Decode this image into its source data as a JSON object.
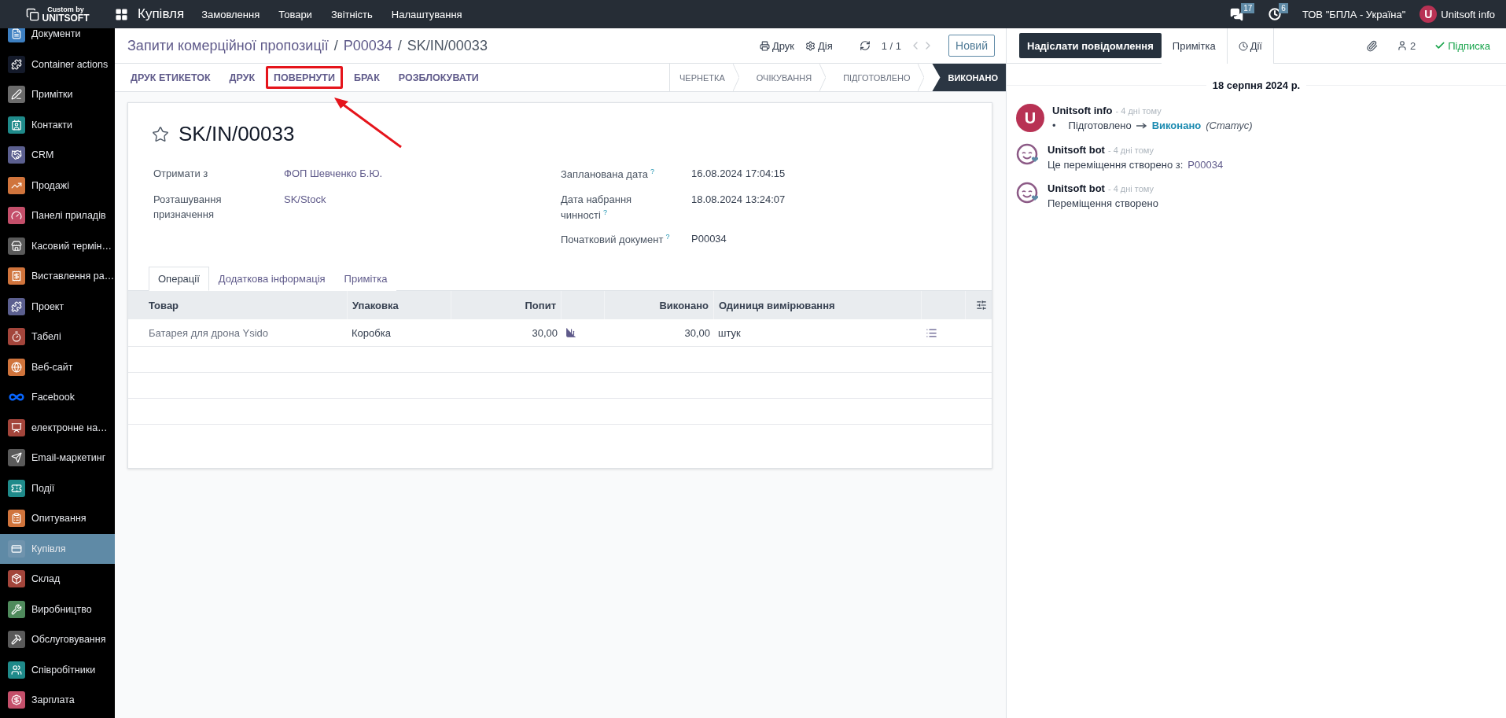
{
  "topbar": {
    "logo_top": "Custom by",
    "logo_bottom": "UNITSOFT",
    "app": "Купівля",
    "menus": [
      "Замовлення",
      "Товари",
      "Звітність",
      "Налаштування"
    ],
    "messages_count": "17",
    "activities_count": "6",
    "company": "ТОВ \"БПЛА - Україна\"",
    "user_initial": "U",
    "user": "Unitsoft info"
  },
  "sidebar": {
    "items": [
      {
        "label": "Документи",
        "kind": "documents",
        "color": "#3d7fc1",
        "selected": false
      },
      {
        "label": "Container actions",
        "kind": "puzzle",
        "color": "#141a2a",
        "selected": false
      },
      {
        "label": "Примітки",
        "kind": "notes",
        "color": "#6b6b6b",
        "selected": false
      },
      {
        "label": "Контакти",
        "kind": "contacts",
        "color": "#1f8a8a",
        "selected": false
      },
      {
        "label": "CRM",
        "kind": "handshake",
        "color": "#5b5f8f",
        "selected": false
      },
      {
        "label": "Продажі",
        "kind": "chart",
        "color": "#d0743c",
        "selected": false
      },
      {
        "label": "Панелі приладів",
        "kind": "gauge",
        "color": "#c44f6a",
        "selected": false
      },
      {
        "label": "Касовий термін…",
        "kind": "store",
        "color": "#5a5a5a",
        "selected": false
      },
      {
        "label": "Виставлення ра…",
        "kind": "invoice",
        "color": "#d0743c",
        "selected": false
      },
      {
        "label": "Проект",
        "kind": "puzzle",
        "color": "#5b5f8f",
        "selected": false
      },
      {
        "label": "Табелі",
        "kind": "timer",
        "color": "#a3453b",
        "selected": false
      },
      {
        "label": "Веб-сайт",
        "kind": "globe",
        "color": "#d0743c",
        "selected": false
      },
      {
        "label": "Facebook",
        "kind": "meta",
        "color": "#0866ff",
        "selected": false
      },
      {
        "label": "електронне на…",
        "kind": "presentation",
        "color": "#a3453b",
        "selected": false
      },
      {
        "label": "Email-маркетинг",
        "kind": "send",
        "color": "#5a5a5a",
        "selected": false
      },
      {
        "label": "Події",
        "kind": "ticket",
        "color": "#1f8a8a",
        "selected": false
      },
      {
        "label": "Опитування",
        "kind": "survey",
        "color": "#d0743c",
        "selected": false
      },
      {
        "label": "Купівля",
        "kind": "card",
        "color": "#6f93ad",
        "selected": true
      },
      {
        "label": "Склад",
        "kind": "package",
        "color": "#a3453b",
        "selected": false
      },
      {
        "label": "Виробництво",
        "kind": "wrench",
        "color": "#4f8a5c",
        "selected": false
      },
      {
        "label": "Обслуговування",
        "kind": "hammer",
        "color": "#5a5a5a",
        "selected": false
      },
      {
        "label": "Співробітники",
        "kind": "users",
        "color": "#1f8a8a",
        "selected": false
      },
      {
        "label": "Зарплата",
        "kind": "payroll",
        "color": "#c44f6a",
        "selected": false
      }
    ]
  },
  "breadcrumbs": [
    "Запити комерційної пропозиції",
    "P00034",
    "SK/IN/00033"
  ],
  "breadcrumb_separator": "/",
  "control": {
    "print": "Друк",
    "action": "Дія",
    "pager": "1 / 1",
    "new": "Новий"
  },
  "actions": [
    {
      "label": "ДРУК ЕТИКЕТОК",
      "highlighted": false
    },
    {
      "label": "ДРУК",
      "highlighted": false
    },
    {
      "label": "ПОВЕРНУТИ",
      "highlighted": true
    },
    {
      "label": "БРАК",
      "highlighted": false
    },
    {
      "label": "РОЗБЛОКУВАТИ",
      "highlighted": false
    }
  ],
  "annotation_arrow": true,
  "stages": [
    {
      "label": "ЧЕРНЕТКА",
      "selected": false
    },
    {
      "label": "ОЧІКУВАННЯ",
      "selected": false
    },
    {
      "label": "ПІДГОТОВЛЕНО",
      "selected": false
    },
    {
      "label": "ВИКОНАНО",
      "selected": true
    }
  ],
  "record": {
    "title": "SK/IN/00033",
    "starred": false,
    "left_fields": [
      {
        "label": "Отримати з",
        "value": "ФОП Шевченко Б.Ю.",
        "kind": "link"
      },
      {
        "label": "Розташування призначення",
        "value": "SK/Stock",
        "kind": "link"
      }
    ],
    "right_fields": [
      {
        "label": "Запланована дата",
        "help": "?",
        "value": "16.08.2024 17:04:15"
      },
      {
        "label": "Дата набрання чинності",
        "help": "?",
        "value": "18.08.2024 13:24:07"
      },
      {
        "label": "Початковий документ",
        "help": "?",
        "value": "P00034"
      }
    ]
  },
  "tabs": [
    {
      "label": "Операції",
      "selected": true
    },
    {
      "label": "Додаткова інформація",
      "selected": false
    },
    {
      "label": "Примітка",
      "selected": false
    }
  ],
  "table": {
    "columns": [
      "Товар",
      "Упаковка",
      "Попит",
      "",
      "Виконано",
      "Одиниця вимірювання"
    ],
    "rows": [
      {
        "product": "Батарея для дрона Ysido",
        "packaging": "Коробка",
        "demand": "30,00",
        "done": "30,00",
        "uom": "штук"
      }
    ]
  },
  "chatter": {
    "buttons": [
      {
        "label": "Надіслати повідомлення",
        "kind": "primary",
        "selected": true
      },
      {
        "label": "Примітка",
        "kind": "tab",
        "selected": false
      },
      {
        "label": "Дії",
        "kind": "activity",
        "selected": false
      }
    ],
    "followers": "2",
    "follow": "Підписка",
    "date": "18 серпня 2024 р.",
    "messages": [
      {
        "author": "Unitsoft info",
        "initial": "U",
        "time": "- 4 дні тому",
        "kind": "tracking",
        "bullet": "•",
        "from": "Підготовлено",
        "to": "Виконано",
        "field": "(Статус)"
      },
      {
        "author": "Unitsoft bot",
        "time": "- 4 дні тому",
        "kind": "link",
        "text": "Це переміщення створено з:",
        "link": "P00034"
      },
      {
        "author": "Unitsoft bot",
        "time": "- 4 дні тому",
        "kind": "text",
        "text": "Переміщення створено"
      }
    ]
  }
}
